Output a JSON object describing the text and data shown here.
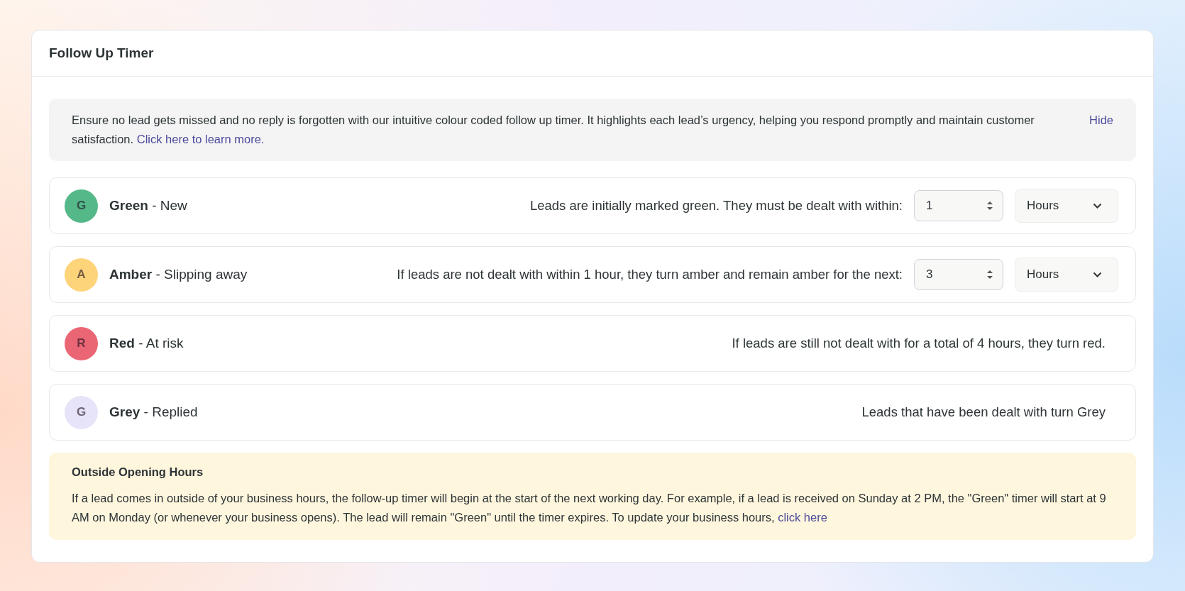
{
  "card": {
    "title": "Follow Up Timer"
  },
  "info": {
    "text": "Ensure no lead gets missed and no reply is forgotten with our intuitive colour coded follow up timer. It highlights each lead’s urgency, helping you respond promptly and maintain customer satisfaction. ",
    "link": "Click here to learn more.",
    "hide": "Hide"
  },
  "tiers": [
    {
      "kind": "input",
      "letter": "G",
      "color": "#55b889",
      "label": "**Green** - New",
      "description": "Leads are initially marked green. They must be dealt with within:",
      "value": "1",
      "unit": "Hours"
    },
    {
      "kind": "input",
      "letter": "A",
      "color": "#fdd47a",
      "label": "**Amber** - Slipping away",
      "description": "If leads are not dealt with within 1 hour, they turn amber and remain amber for the next:",
      "value": "3",
      "unit": "Hours"
    },
    {
      "kind": "text",
      "letter": "R",
      "color": "#eb6674",
      "label": "**Red** - At risk",
      "description": "If leads are still not dealt with for a total of 4 hours, they turn red."
    },
    {
      "kind": "text",
      "letter": "G",
      "color": "#e7e3f8",
      "label": "**Grey** - Replied",
      "description": "Leads that have been dealt with turn Grey"
    }
  ],
  "notice": {
    "title": "Outside Opening Hours",
    "text": "If a lead comes in outside of your business hours, the follow-up timer will begin at the start of the next working day. For example, if a lead is received on Sunday at 2 PM, the \"Green\" timer will start at 9 AM on Monday (or whenever your business opens). The lead will remain \"Green\" until the timer expires. To update your business hours, ",
    "link": "click here"
  }
}
